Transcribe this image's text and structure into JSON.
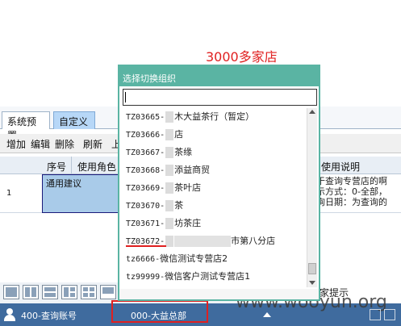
{
  "annotation": "3000多家店",
  "tabs": {
    "system": "系统预置",
    "custom": "自定义"
  },
  "toolbar": [
    "增加",
    "编辑",
    "删除",
    "刷新",
    "上"
  ],
  "grid": {
    "headers": [
      "序号",
      "使用角色",
      "使用说明"
    ],
    "row": {
      "number": "1",
      "purpose": "通用建议",
      "description_lines": [
        "于查询专营店的啊",
        "示方式：0-全部，",
        "询日期：为查询的"
      ]
    }
  },
  "hint_label": "家提示",
  "popup": {
    "title": "选择切换组织",
    "search_value": "",
    "items": [
      {
        "code": "TZ03665-",
        "name": "木大益茶行（暂定）"
      },
      {
        "code": "TZ03666-",
        "name": "店"
      },
      {
        "code": "TZ03667-",
        "name": "茶缘"
      },
      {
        "code": "TZ03668-",
        "name": "添益商贸"
      },
      {
        "code": "TZ03669-",
        "name": "茶叶店"
      },
      {
        "code": "TZ03670-",
        "name": "茶"
      },
      {
        "code": "TZ03671-",
        "name": "坊茶庄"
      },
      {
        "code": "TZ03672-",
        "name": "市第八分店"
      },
      {
        "code": "tz6666-",
        "name": "微信测试专营店2"
      },
      {
        "code": "tz99999-",
        "name": "微信客户测试专营店1"
      }
    ]
  },
  "status": {
    "user": "400-查询账号",
    "org": "000-大益总部"
  },
  "watermark": "www.wooyun.org",
  "colors": {
    "popup_accent": "#5ab4a3",
    "status_bar": "#3f6b9e",
    "annotation": "#e02020",
    "selection": "#a9cbe9"
  }
}
